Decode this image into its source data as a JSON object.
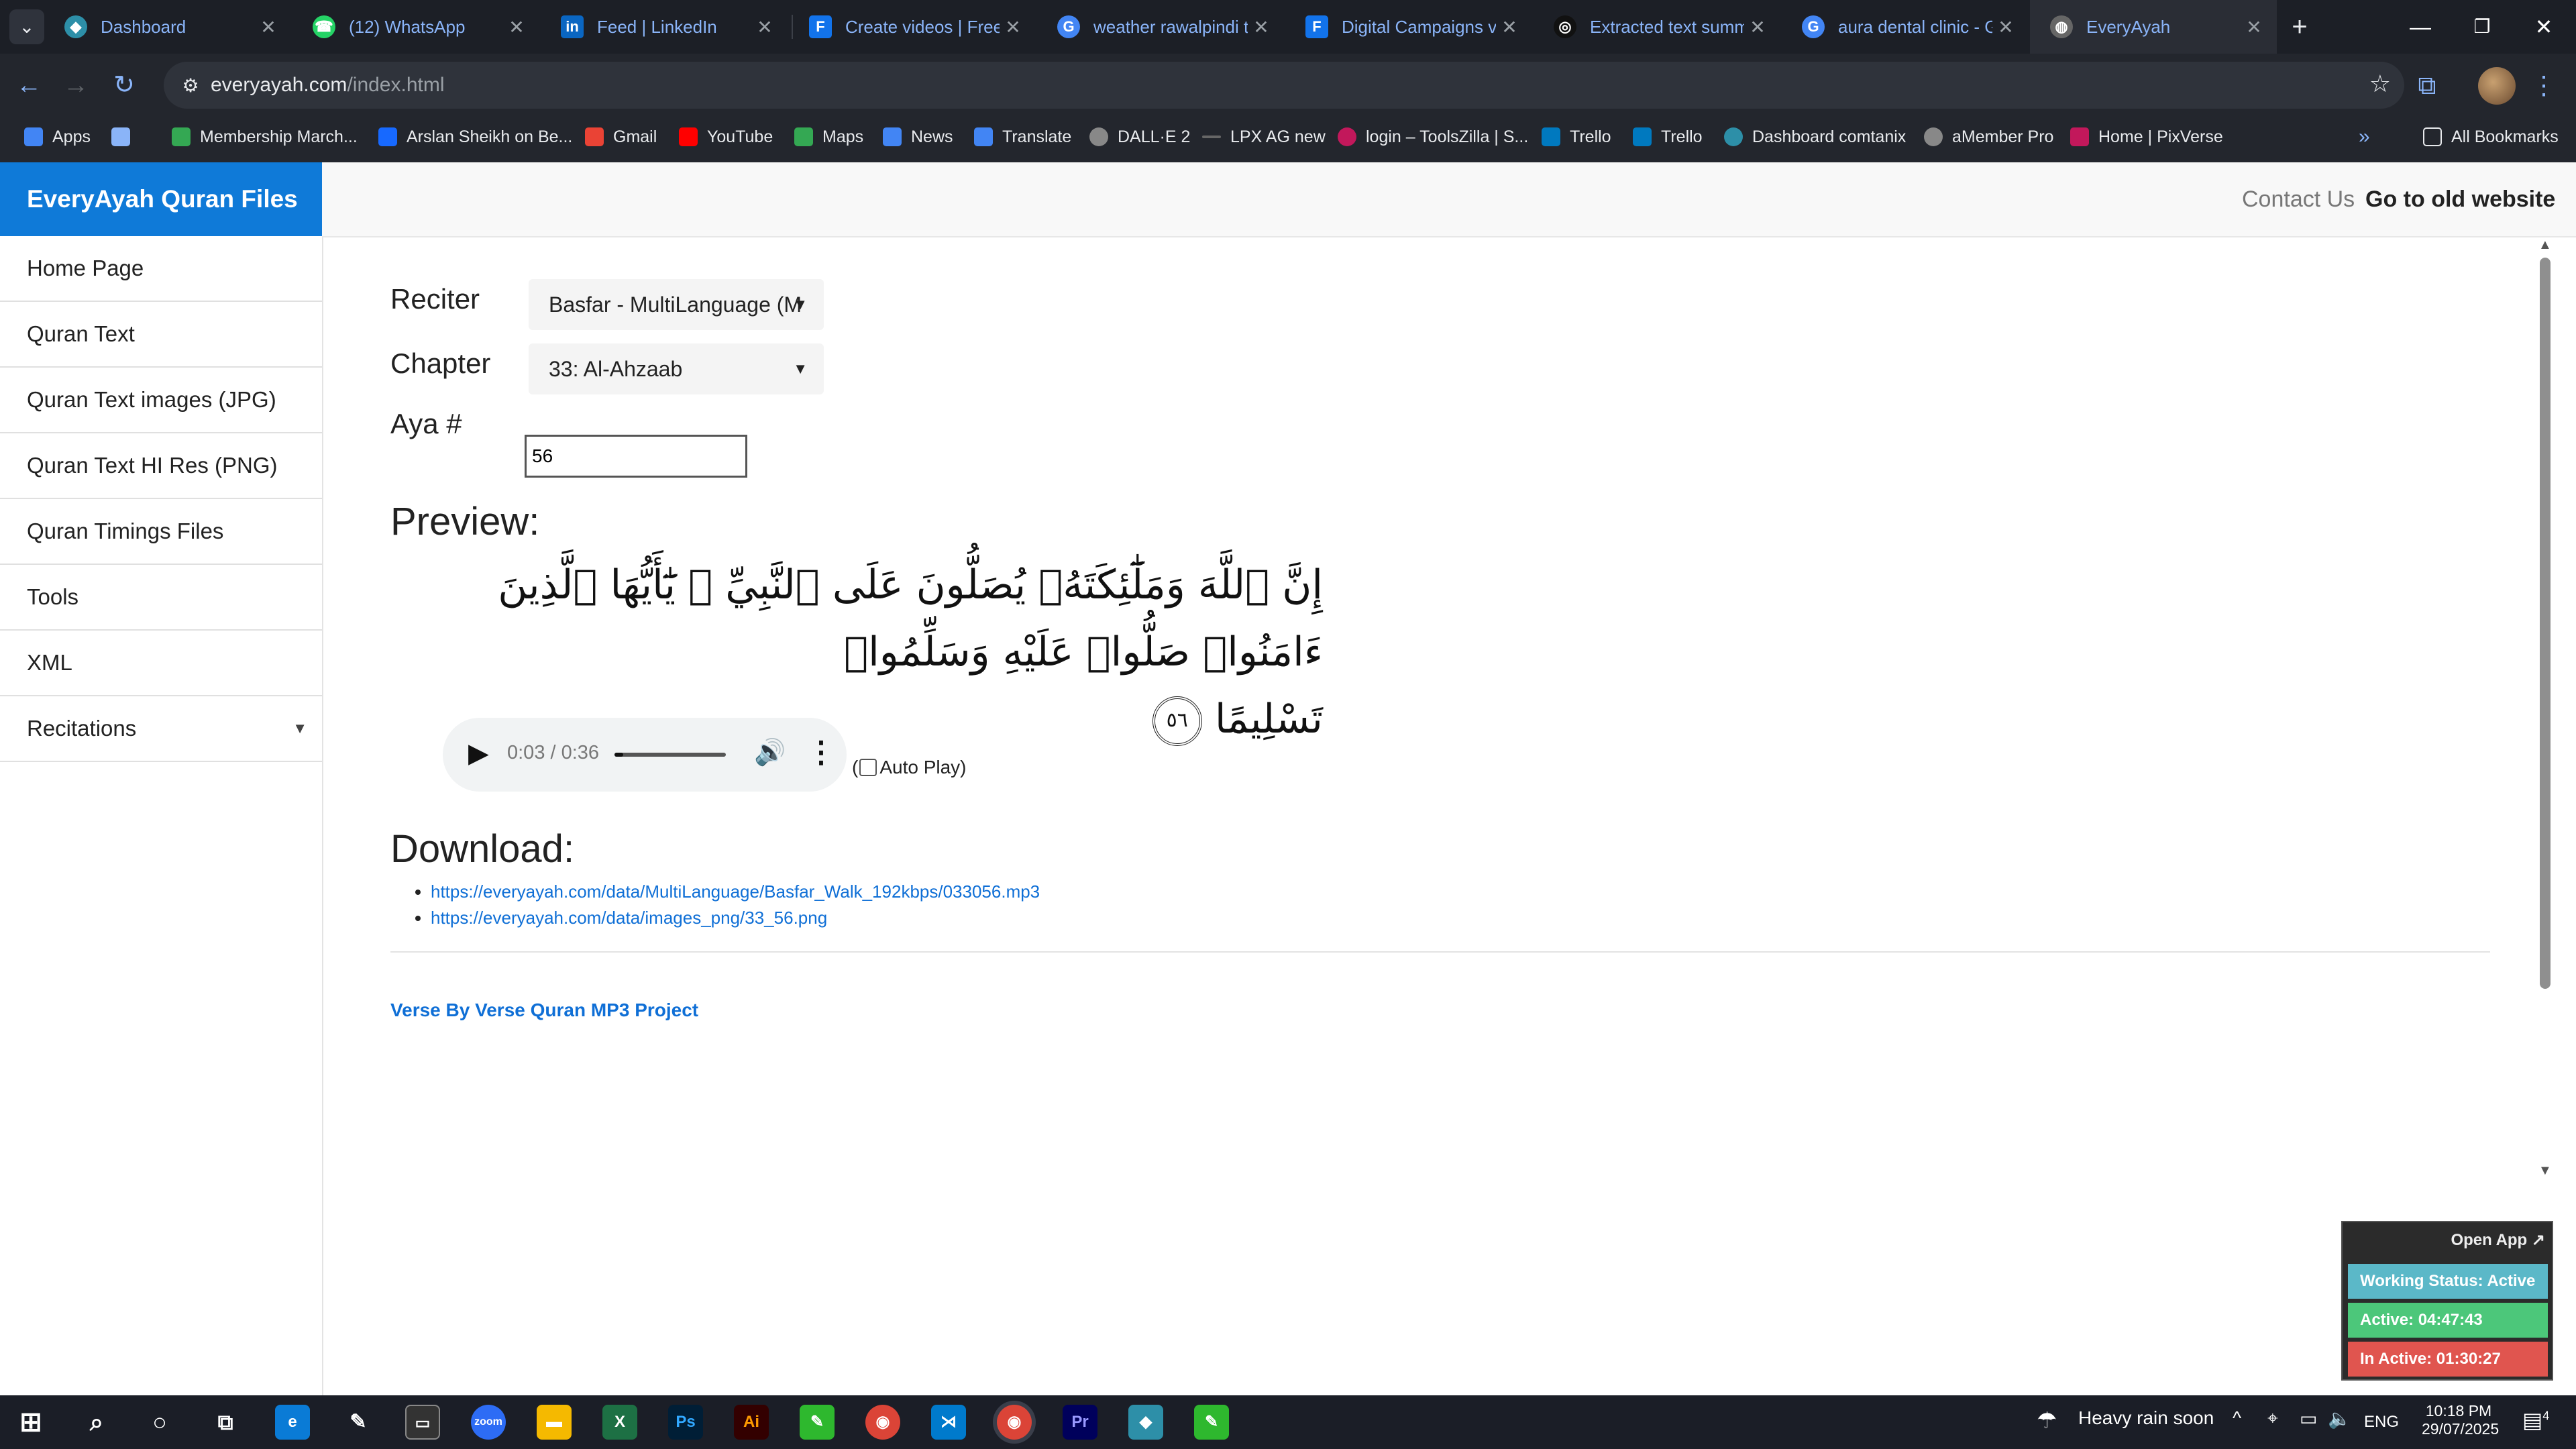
{
  "browser": {
    "tabs": [
      {
        "title": "Dashboard",
        "icon": "dashboard-favicon",
        "color": "#2d8fa8"
      },
      {
        "title": "(12) WhatsApp",
        "icon": "whatsapp-favicon",
        "color": "#25d366"
      },
      {
        "title": "Feed | LinkedIn",
        "icon": "linkedin-favicon",
        "color": "#0a66c2"
      },
      {
        "title": "Create videos | Freep",
        "icon": "freepik-favicon",
        "color": "#1273eb"
      },
      {
        "title": "weather rawalpindi to",
        "icon": "google-favicon",
        "color": "#4285f4"
      },
      {
        "title": "Digital Campaigns ve",
        "icon": "forms-favicon",
        "color": "#1273eb"
      },
      {
        "title": "Extracted text summ",
        "icon": "openai-favicon",
        "color": "#111111"
      },
      {
        "title": "aura dental clinic - G",
        "icon": "google-favicon",
        "color": "#4285f4"
      },
      {
        "title": "EveryAyah",
        "icon": "globe-favicon",
        "color": "#666666"
      }
    ],
    "url_domain": "everyayah.com",
    "url_path": "/index.html",
    "bookmarks": [
      {
        "label": "Apps",
        "color": "#4285f4"
      },
      {
        "label": "Membership March...",
        "color": "#34a853"
      },
      {
        "label": "Arslan Sheikh on Be...",
        "color": "#1769ff"
      },
      {
        "label": "Gmail",
        "color": "#ea4335"
      },
      {
        "label": "YouTube",
        "color": "#ff0000"
      },
      {
        "label": "Maps",
        "color": "#34a853"
      },
      {
        "label": "News",
        "color": "#4285f4"
      },
      {
        "label": "Translate",
        "color": "#4285f4"
      },
      {
        "label": "DALL·E 2",
        "color": "#888888"
      },
      {
        "label": "LPX AG new",
        "color": "#666666"
      },
      {
        "label": "login – ToolsZilla | S...",
        "color": "#c2185b"
      },
      {
        "label": "Trello",
        "color": "#0079bf"
      },
      {
        "label": "Trello",
        "color": "#0079bf"
      },
      {
        "label": "Dashboard comtanix",
        "color": "#2d8fa8"
      },
      {
        "label": "aMember Pro",
        "color": "#888888"
      },
      {
        "label": "Home | PixVerse",
        "color": "#c2185b"
      }
    ],
    "all_bookmarks": "All Bookmarks"
  },
  "site": {
    "brand": "EveryAyah Quran Files",
    "contact": "Contact Us",
    "old_site": "Go to old website",
    "sidebar": [
      "Home Page",
      "Quran Text",
      "Quran Text images (JPG)",
      "Quran Text HI Res (PNG)",
      "Quran Timings Files",
      "Tools",
      "XML",
      "Recitations"
    ]
  },
  "form": {
    "reciter_label": "Reciter",
    "reciter_value": "Basfar - MultiLanguage (M",
    "chapter_label": "Chapter",
    "chapter_value": "33: Al-Ahzaab",
    "aya_label": "Aya #",
    "aya_value": "56"
  },
  "preview": {
    "heading": "Preview:",
    "verse_line1": "إِنَّ ٱللَّهَ وَمَلَٰٓئِكَتَهُۥ يُصَلُّونَ عَلَى ٱلنَّبِيِّ ۚ يَٰٓأَيُّهَا ٱلَّذِينَ ءَامَنُوا۟ صَلُّوا۟ عَلَيْهِ وَسَلِّمُوا۟",
    "verse_line2": "تَسْلِيمًا",
    "aya_number": "٥٦"
  },
  "audio": {
    "time": "0:03 / 0:36",
    "progress_fraction": 0.08,
    "autoplay_label": "Auto Play)",
    "autoplay_prefix": "("
  },
  "download": {
    "heading": "Download:",
    "links": [
      "https://everyayah.com/data/MultiLanguage/Basfar_Walk_192kbps/033056.mp3",
      "https://everyayah.com/data/images_png/33_56.png"
    ]
  },
  "footer": {
    "project": "Verse By Verse Quran MP3 Project"
  },
  "widget": {
    "open_app": "Open App ↗",
    "status": "Working Status: Active",
    "active": "Active: 04:47:43",
    "inactive": "In Active: 01:30:27",
    "colors": {
      "status": "#5bb8c8",
      "active": "#4cc77a",
      "inactive": "#e0554f"
    }
  },
  "taskbar": {
    "weather": "Heavy rain soon",
    "lang": "ENG",
    "time": "10:18 PM",
    "date": "29/07/2025",
    "notifications": "4"
  }
}
